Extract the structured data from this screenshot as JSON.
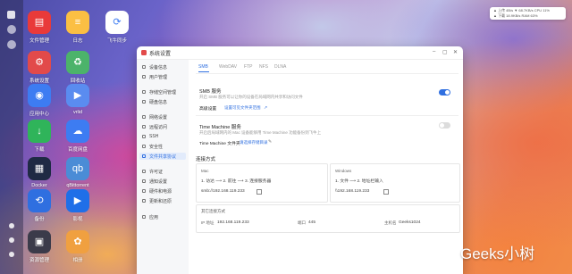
{
  "tray": {
    "row1": "▲  上传   4B/s  ▼  68.7KB/s  CPU 11%",
    "row2": "▲  下载   18.9KB/s  RAM 63%"
  },
  "desktop": {
    "apps": [
      {
        "label": "文件管理",
        "color": "#e93a3a",
        "glyph": "▤"
      },
      {
        "label": "日志",
        "color": "#fbbf43",
        "glyph": "≡"
      },
      {
        "label": "飞牛同步",
        "color": "#ffffff",
        "glyph": "⟳"
      },
      {
        "label": "系统设置",
        "color": "#e24a4a",
        "glyph": "⚙"
      },
      {
        "label": "回收站",
        "color": "#4cb36a",
        "glyph": "♻"
      },
      {
        "label": "应用中心",
        "color": "#3d7cf2",
        "glyph": "◉"
      },
      {
        "label": "vrlid",
        "color": "#5a8cf0",
        "glyph": "▶"
      },
      {
        "label": "下载",
        "color": "#2fb45a",
        "glyph": "↓"
      },
      {
        "label": "百度网盘",
        "color": "#3d7cf2",
        "glyph": "☁"
      },
      {
        "label": "Docker",
        "color": "#1f2a44",
        "glyph": "▦"
      },
      {
        "label": "qBittorrent",
        "color": "#4b8cd6",
        "glyph": "qb"
      },
      {
        "label": "备份",
        "color": "#2f6fe0",
        "glyph": "⟲"
      },
      {
        "label": "影视",
        "color": "#1f6fe8",
        "glyph": "▶"
      },
      {
        "label": "资源管理",
        "color": "#3b3b4a",
        "glyph": "▣"
      },
      {
        "label": "相册",
        "color": "#f0a040",
        "glyph": "✿"
      }
    ]
  },
  "window": {
    "title": "系统设置"
  },
  "sidebar": {
    "items": [
      {
        "label": "设备信息",
        "active": false
      },
      {
        "label": "用户管理",
        "active": false
      },
      {
        "label": "存储空间管理",
        "active": false
      },
      {
        "label": "硬盘信息",
        "active": false
      },
      {
        "label": "网络设置",
        "active": false
      },
      {
        "label": "远程访问",
        "active": false
      },
      {
        "label": "SSH",
        "active": false
      },
      {
        "label": "安全性",
        "active": false
      },
      {
        "label": "文件共享协议",
        "active": true
      },
      {
        "label": "许可证",
        "active": false
      },
      {
        "label": "通知设置",
        "active": false
      },
      {
        "label": "硬件和电源",
        "active": false
      },
      {
        "label": "更新和还原",
        "active": false
      },
      {
        "label": "应用",
        "active": false
      }
    ]
  },
  "tabs": [
    {
      "label": "SMB",
      "active": true
    },
    {
      "label": "WebDAV",
      "active": false
    },
    {
      "label": "FTP",
      "active": false
    },
    {
      "label": "NFS",
      "active": false
    },
    {
      "label": "DLNA",
      "active": false
    }
  ],
  "smb": {
    "title": "SMB 服务",
    "desc": "开启 SMB 服务可以让你的设备在局域网内共享和访问文件",
    "enabled": true,
    "advanced": "高级设置",
    "range": "设置可见文件夹范围",
    "range_icon": "external-link"
  },
  "tm": {
    "title": "Time Machine 服务",
    "desc": "开启后局域网内的 Mac 设备能够用 Time Machine 功能备份到飞牛上",
    "enabled": false,
    "folder_label": "Time Machine 文件夹",
    "folder_link": "请选择存储目录"
  },
  "connect": {
    "title": "连接方式",
    "mac": {
      "os": "Mac",
      "steps": "1. 访达  ⟶  2. 前往  ⟶  3. 连接服务器",
      "address": "smb://192.168.119.233"
    },
    "windows": {
      "os": "Windows",
      "steps": "1. 文件  ⟶  2. 地址栏输入",
      "address": "\\\\192.168.119.233"
    }
  },
  "other": {
    "title": "其它连接方式",
    "ip_label": "IP 地址",
    "ip": "192.168.119.233",
    "port_label": "端口",
    "port": "445",
    "host_label": "主机名",
    "host": "Geeks1024"
  },
  "watermark": "Geeks小树",
  "colors": {
    "accent": "#2f6fe0",
    "toggle_off": "#dcdcdc"
  }
}
